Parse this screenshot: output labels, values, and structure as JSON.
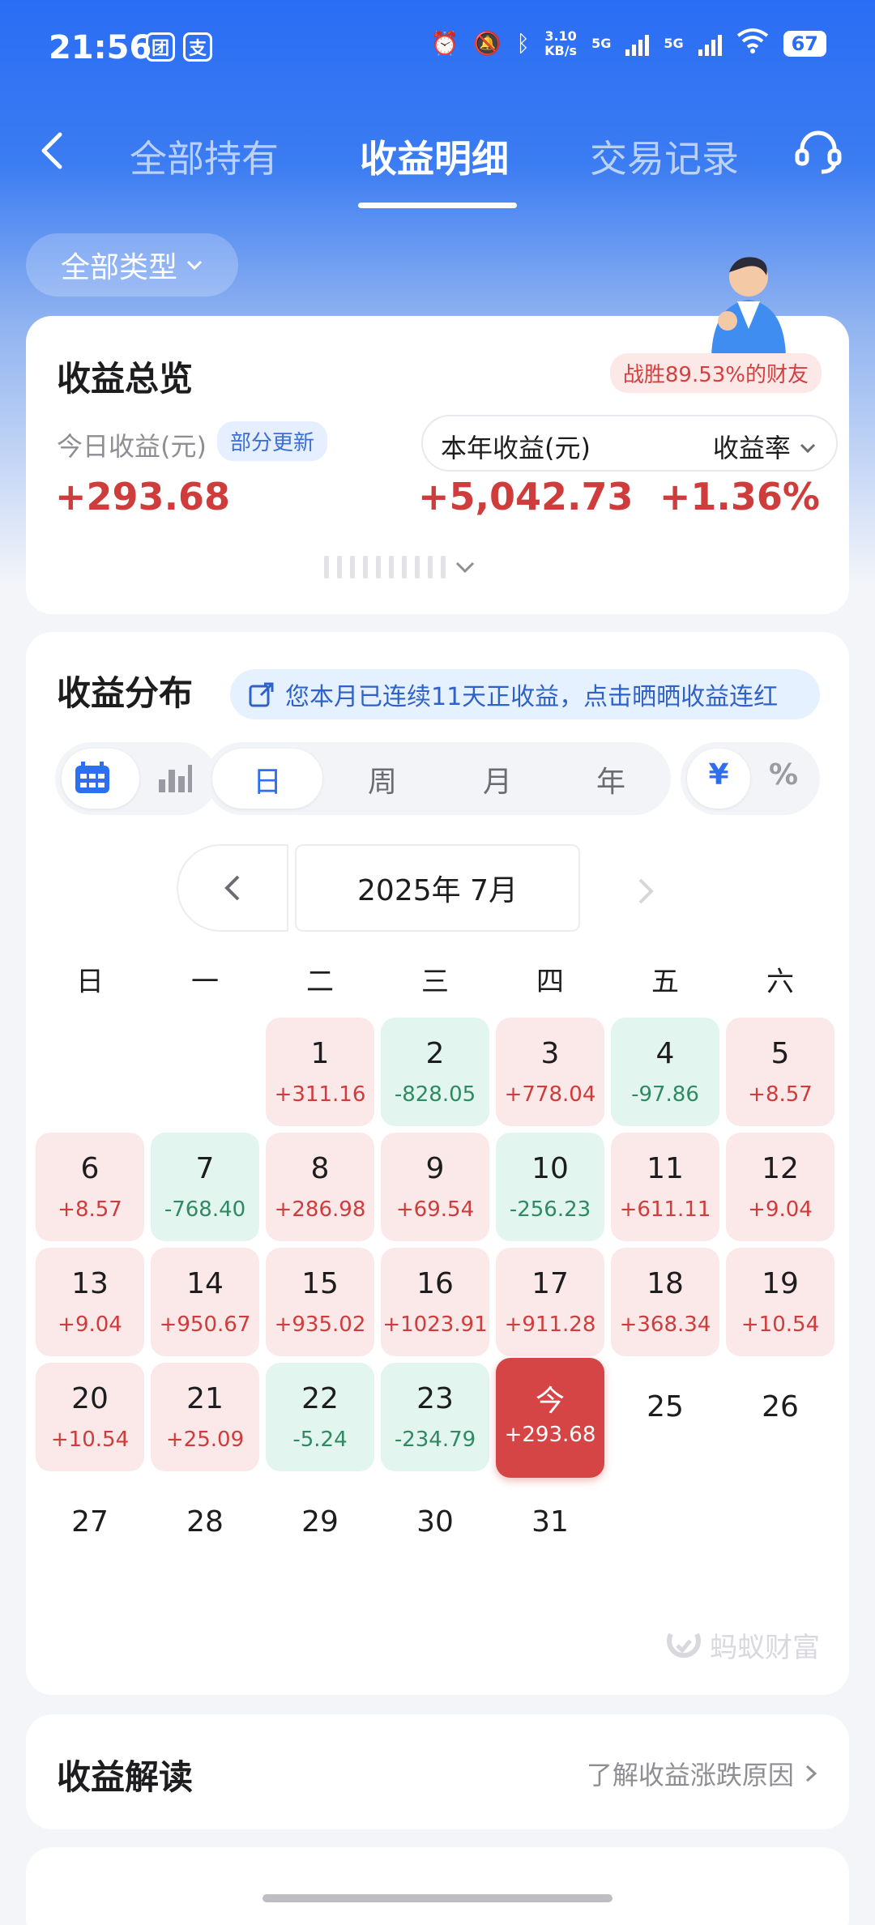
{
  "status_bar": {
    "time": "21:56",
    "badges": [
      "团",
      "支"
    ],
    "net_speed_value": "3.10",
    "net_speed_unit": "KB/s",
    "signal1": "5G",
    "signal2": "5G",
    "battery": "67",
    "icons": [
      "alarm-icon",
      "mute-icon",
      "bluetooth-icon",
      "wifi-icon"
    ]
  },
  "nav": {
    "tabs": [
      "全部持有",
      "收益明细",
      "交易记录"
    ],
    "active_tab": 1
  },
  "filter": {
    "label": "全部类型"
  },
  "overview": {
    "title": "收益总览",
    "rank_badge": "战胜89.53%的财友",
    "today_label": "今日收益(元)",
    "today_tag": "部分更新",
    "today_value": "+293.68",
    "year_label": "本年收益(元)",
    "rate_label": "收益率",
    "year_value": "+5,042.73",
    "rate_value": "+1.36%"
  },
  "distribution": {
    "title": "收益分布",
    "streak_text": "您本月已连续11天正收益，点击晒晒收益连红",
    "periods": [
      "日",
      "周",
      "月",
      "年"
    ],
    "active_period": 0,
    "units": [
      "¥",
      "%"
    ],
    "active_unit": 0,
    "month_label": "2025年 7月",
    "weekdays": [
      "日",
      "一",
      "二",
      "三",
      "四",
      "五",
      "六"
    ],
    "days": [
      {
        "d": "1",
        "v": "+311.16",
        "s": "pos"
      },
      {
        "d": "2",
        "v": "-828.05",
        "s": "neg"
      },
      {
        "d": "3",
        "v": "+778.04",
        "s": "pos"
      },
      {
        "d": "4",
        "v": "-97.86",
        "s": "neg"
      },
      {
        "d": "5",
        "v": "+8.57",
        "s": "pos"
      },
      {
        "d": "6",
        "v": "+8.57",
        "s": "pos"
      },
      {
        "d": "7",
        "v": "-768.40",
        "s": "neg"
      },
      {
        "d": "8",
        "v": "+286.98",
        "s": "pos"
      },
      {
        "d": "9",
        "v": "+69.54",
        "s": "pos"
      },
      {
        "d": "10",
        "v": "-256.23",
        "s": "neg"
      },
      {
        "d": "11",
        "v": "+611.11",
        "s": "pos"
      },
      {
        "d": "12",
        "v": "+9.04",
        "s": "pos"
      },
      {
        "d": "13",
        "v": "+9.04",
        "s": "pos"
      },
      {
        "d": "14",
        "v": "+950.67",
        "s": "pos"
      },
      {
        "d": "15",
        "v": "+935.02",
        "s": "pos"
      },
      {
        "d": "16",
        "v": "+1023.91",
        "s": "pos"
      },
      {
        "d": "17",
        "v": "+911.28",
        "s": "pos"
      },
      {
        "d": "18",
        "v": "+368.34",
        "s": "pos"
      },
      {
        "d": "19",
        "v": "+10.54",
        "s": "pos"
      },
      {
        "d": "20",
        "v": "+10.54",
        "s": "pos"
      },
      {
        "d": "21",
        "v": "+25.09",
        "s": "pos"
      },
      {
        "d": "22",
        "v": "-5.24",
        "s": "neg"
      },
      {
        "d": "23",
        "v": "-234.79",
        "s": "neg"
      },
      {
        "d": "今",
        "v": "+293.68",
        "s": "today"
      },
      {
        "d": "25",
        "v": "",
        "s": "empty"
      },
      {
        "d": "26",
        "v": "",
        "s": "empty"
      },
      {
        "d": "27",
        "v": "",
        "s": "empty"
      },
      {
        "d": "28",
        "v": "",
        "s": "empty"
      },
      {
        "d": "29",
        "v": "",
        "s": "empty"
      },
      {
        "d": "30",
        "v": "",
        "s": "empty"
      },
      {
        "d": "31",
        "v": "",
        "s": "empty"
      }
    ],
    "brand": "蚂蚁财富"
  },
  "interpretation": {
    "title": "收益解读",
    "link": "了解收益涨跌原因"
  },
  "colors": {
    "primary_blue": "#2a6df4",
    "positive_red": "#cf3c3c",
    "negative_green": "#2f8a63",
    "today_red": "#d64545"
  }
}
